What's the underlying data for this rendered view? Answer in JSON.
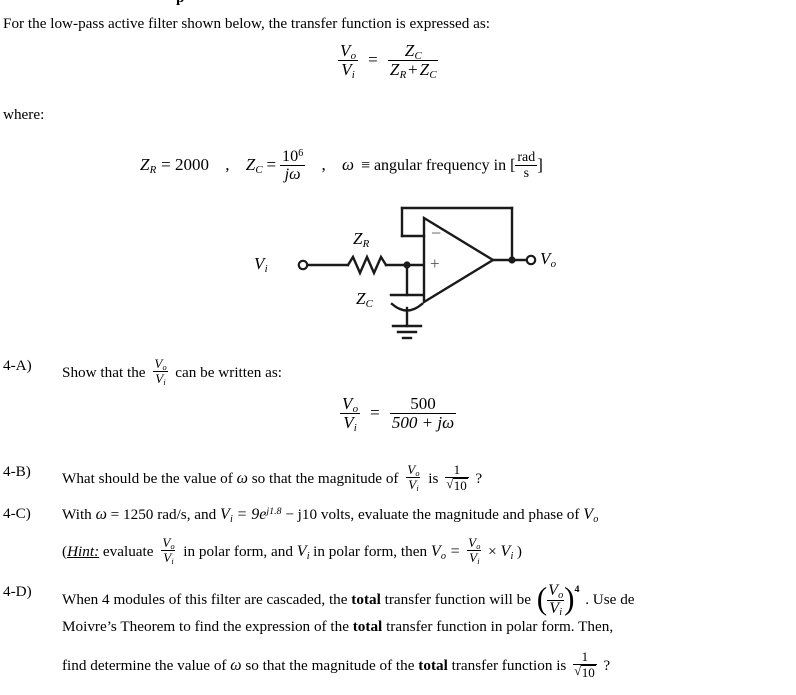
{
  "document": {
    "intro": "For the low-pass active filter shown below, the transfer function is expressed as:",
    "where_label": "where:"
  },
  "equations": {
    "transfer_function": {
      "lhs_num": "V",
      "lhs_num_sub": "o",
      "lhs_den": "V",
      "lhs_den_sub": "i",
      "equals": "=",
      "rhs_num": "Z",
      "rhs_num_sub": "C",
      "rhs_den_first": "Z",
      "rhs_den_first_sub": "R",
      "rhs_den_plus": "+",
      "rhs_den_second": "Z",
      "rhs_den_second_sub": "C"
    },
    "definitions": {
      "zr_symbol": "Z",
      "zr_sub": "R",
      "zr_equals": "= 2000",
      "comma1": ",",
      "zc_symbol": "Z",
      "zc_sub": "C",
      "zc_equals": "=",
      "zc_num": "10",
      "zc_num_exp": "6",
      "zc_den_j": "j",
      "zc_den_omega": "ω",
      "comma2": ",",
      "omega_symbol": "ω",
      "omega_def": "≡ angular frequency in [",
      "unit_num": "rad",
      "unit_den": "s",
      "bracket_close": "]"
    },
    "result": {
      "lhs_num": "V",
      "lhs_num_sub": "o",
      "lhs_den": "V",
      "lhs_den_sub": "i",
      "equals": "=",
      "rhs_num": "500",
      "rhs_den": "500 + jω"
    }
  },
  "circuit": {
    "label_vi": "V",
    "label_vi_sub": "i",
    "label_vo": "V",
    "label_vo_sub": "o",
    "label_zr": "Z",
    "label_zr_sub": "R",
    "label_zc": "Z",
    "label_zc_sub": "C",
    "opamp_minus": "−",
    "opamp_plus": "+"
  },
  "parts": {
    "a": {
      "tag": "4-A)",
      "text_before": "Show that the",
      "frac_num": "V",
      "frac_num_sub": "o",
      "frac_den": "V",
      "frac_den_sub": "i",
      "text_after": "can be written as:"
    },
    "b": {
      "tag": "4-B)",
      "text_before": "What should be the value of",
      "omega": "ω",
      "text_mid": "so that the magnitude of",
      "frac_num": "V",
      "frac_num_sub": "o",
      "frac_den": "V",
      "frac_den_sub": "i",
      "text_is": "is",
      "value_num": "1",
      "value_den_radicand": "10",
      "question_mark": "?"
    },
    "c": {
      "tag": "4-C)",
      "line1_a": "With",
      "line1_omega": "ω",
      "line1_b": "= 1250 rad/s, and",
      "line1_vi": "V",
      "line1_vi_sub": "i",
      "line1_c": "= 9e",
      "line1_exp": "j1.8",
      "line1_d": "− j10  volts, evaluate the magnitude and phase of",
      "line1_vo": "V",
      "line1_vo_sub": "o",
      "line2_paren": "(",
      "line2_hint": "Hint:",
      "line2_a": "evaluate",
      "line2_frac_num": "V",
      "line2_frac_num_sub": "o",
      "line2_frac_den": "V",
      "line2_frac_den_sub": "i",
      "line2_b": "in polar form, and",
      "line2_vi": "V",
      "line2_vi_sub": "i",
      "line2_c": "in polar form, then",
      "line2_vo": "V",
      "line2_vo_sub": "o",
      "line2_eq": "=",
      "line2_frac2_num": "V",
      "line2_frac2_num_sub": "o",
      "line2_frac2_den": "V",
      "line2_frac2_den_sub": "i",
      "line2_times": "×",
      "line2_vi2": "V",
      "line2_vi2_sub": "i",
      "line2_close": ")"
    },
    "d": {
      "tag": "4-D)",
      "line1_a": "When 4 modules of this filter are cascaded, the",
      "line1_bold": "total",
      "line1_b": "transfer function will be",
      "frac_num": "V",
      "frac_num_sub": "o",
      "frac_den": "V",
      "frac_den_sub": "i",
      "power": "4",
      "line1_c": ". Use de",
      "line2_a": "Moivre’s Theorem to find the expression of the",
      "line2_bold": "total",
      "line2_b": "transfer function in polar form.  Then,",
      "line3_a": "find determine the value of",
      "line3_omega": "ω",
      "line3_b": "so that the magnitude of the",
      "line3_bold": "total",
      "line3_c": "transfer function is",
      "value_num": "1",
      "value_den_radicand": "10",
      "question_mark": "?"
    }
  },
  "colors": {
    "text": "#000000",
    "background": "#ffffff",
    "wire": "#1a1a1a"
  }
}
